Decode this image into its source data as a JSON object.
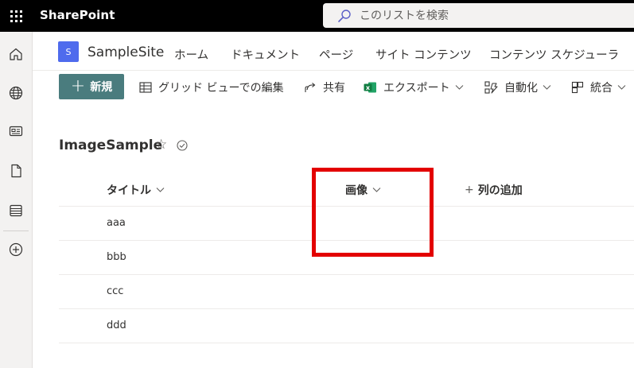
{
  "suitebar": {
    "brand": "SharePoint",
    "search_placeholder": "このリストを検索"
  },
  "rail": {
    "icons": [
      "home-icon",
      "globe-icon",
      "news-icon",
      "document-icon",
      "lists-icon",
      "create-icon"
    ]
  },
  "site": {
    "logo_letter": "S",
    "name": "SampleSite",
    "nav": [
      "ホーム",
      "ドキュメント",
      "ページ",
      "サイト コンテンツ",
      "コンテンツ スケジューラ"
    ]
  },
  "commandbar": {
    "new_label": "新規",
    "grid_edit_label": "グリッド ビューでの編集",
    "share_label": "共有",
    "export_label": "エクスポート",
    "automate_label": "自動化",
    "integrate_label": "統合"
  },
  "list": {
    "title": "ImageSample",
    "columns": {
      "title": "タイトル",
      "image": "画像",
      "add_column": "列の追加"
    },
    "rows": [
      {
        "title": "aaa"
      },
      {
        "title": "bbb"
      },
      {
        "title": "ccc"
      },
      {
        "title": "ddd"
      }
    ]
  },
  "colors": {
    "suitebar_bg": "#000000",
    "accent": "#4a7c7e",
    "site_logo": "#4f6bed",
    "highlight": "#e30000"
  }
}
